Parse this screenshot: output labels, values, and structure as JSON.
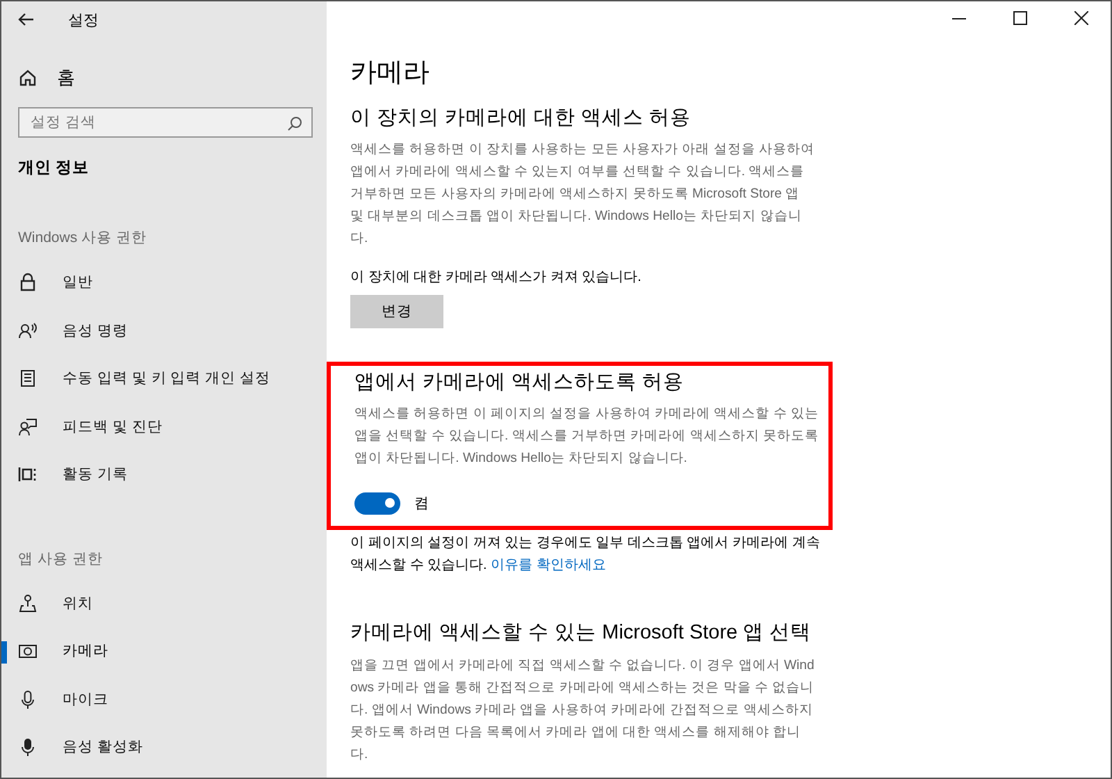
{
  "window": {
    "title": "설정"
  },
  "sidebar": {
    "home": "홈",
    "search": {
      "placeholder": "설정 검색"
    },
    "category": "개인 정보",
    "sections": [
      {
        "heading": "Windows 사용 권한",
        "items": [
          {
            "label": "일반",
            "selected": false
          },
          {
            "label": "음성 명령",
            "selected": false
          },
          {
            "label": "수동 입력 및 키 입력 개인 설정",
            "selected": false
          },
          {
            "label": "피드백 및 진단",
            "selected": false
          },
          {
            "label": "활동 기록",
            "selected": false
          }
        ]
      },
      {
        "heading": "앱 사용 권한",
        "items": [
          {
            "label": "위치",
            "selected": false
          },
          {
            "label": "카메라",
            "selected": true
          },
          {
            "label": "마이크",
            "selected": false
          },
          {
            "label": "음성 활성화",
            "selected": false
          }
        ]
      }
    ]
  },
  "page": {
    "title": "카메라",
    "device_section": {
      "heading": "이 장치의 카메라에 대한 액세스 허용",
      "description": "액세스를 허용하면 이 장치를 사용하는 모든 사용자가 아래 설정을 사용하여 앱에서 카메라에 액세스할 수 있는지 여부를 선택할 수 있습니다. 액세스를 거부하면 모든 사용자의 카메라에 액세스하지 못하도록 Microsoft Store 앱 및 대부분의 데스크톱 앱이 차단됩니다. Windows Hello는 차단되지 않습니다.",
      "status": "이 장치에 대한 카메라 액세스가 켜져 있습니다.",
      "button": "변경"
    },
    "apps_section": {
      "highlighted": true,
      "heading": "앱에서 카메라에 액세스하도록 허용",
      "description": "액세스를 허용하면 이 페이지의 설정을 사용하여 카메라에 액세스할 수 있는 앱을 선택할 수 있습니다. 액세스를 거부하면 카메라에 액세스하지 못하도록 앱이 차단됩니다. Windows Hello는 차단되지 않습니다.",
      "toggle": {
        "on": true,
        "label": "켬"
      }
    },
    "note": {
      "text": "이 페이지의 설정이 꺼져 있는 경우에도 일부 데스크톱 앱에서 카메라에 계속 액세스할 수 있습니다.",
      "link": "이유를 확인하세요"
    },
    "store_section": {
      "heading": "카메라에 액세스할 수 있는 Microsoft Store 앱 선택",
      "description": "앱을 끄면 앱에서 카메라에 직접 액세스할 수 없습니다. 이 경우 앱에서 Windows 카메라 앱을 통해 간접적으로 카메라에 액세스하는 것은 막을 수 없습니다. 앱에서 Windows 카메라 앱을 사용하여 카메라에 간접적으로 액세스하지 못하도록 하려면 다음 목록에서 카메라 앱에 대한 액세스를 해제해야 합니다."
    }
  }
}
